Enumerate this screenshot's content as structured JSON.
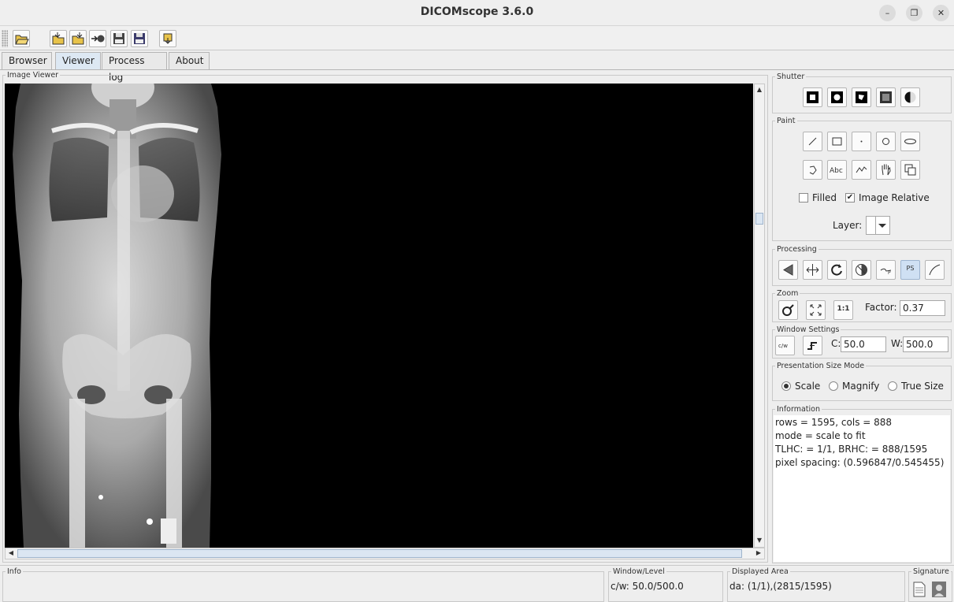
{
  "window": {
    "title": "DICOMscope 3.6.0"
  },
  "tabs": [
    {
      "label": "Browser"
    },
    {
      "label": "Viewer",
      "active": true
    },
    {
      "label": "Process log"
    },
    {
      "label": "About"
    }
  ],
  "viewer": {
    "legend": "Image Viewer"
  },
  "shutter": {
    "legend": "Shutter"
  },
  "paint": {
    "legend": "Paint",
    "filled_label": "Filled",
    "filled_checked": false,
    "image_relative_label": "Image Relative",
    "image_relative_checked": true,
    "layer_label": "Layer:"
  },
  "processing": {
    "legend": "Processing",
    "ps_label": "PS"
  },
  "zoom": {
    "legend": "Zoom",
    "factor_label": "Factor:",
    "factor_value": "0.37",
    "one_to_one": "1:1"
  },
  "window_settings": {
    "legend": "Window Settings",
    "c_label": "C:",
    "c_value": "50.0",
    "w_label": "W:",
    "w_value": "500.0"
  },
  "presentation": {
    "legend": "Presentation Size Mode",
    "options": [
      {
        "label": "Scale",
        "selected": true
      },
      {
        "label": "Magnify",
        "selected": false
      },
      {
        "label": "True Size",
        "selected": false
      }
    ]
  },
  "information": {
    "legend": "Information",
    "lines": [
      "rows = 1595, cols = 888",
      "mode = scale to fit",
      "TLHC: = 1/1, BRHC: = 888/1595",
      "pixel spacing: (0.596847/0.545455)"
    ]
  },
  "status": {
    "info_legend": "Info",
    "window_level_legend": "Window/Level",
    "window_level_value": "c/w: 50.0/500.0",
    "displayed_area_legend": "Displayed Area",
    "displayed_area_value": "da: (1/1),(2815/1595)",
    "signature_legend": "Signature"
  }
}
